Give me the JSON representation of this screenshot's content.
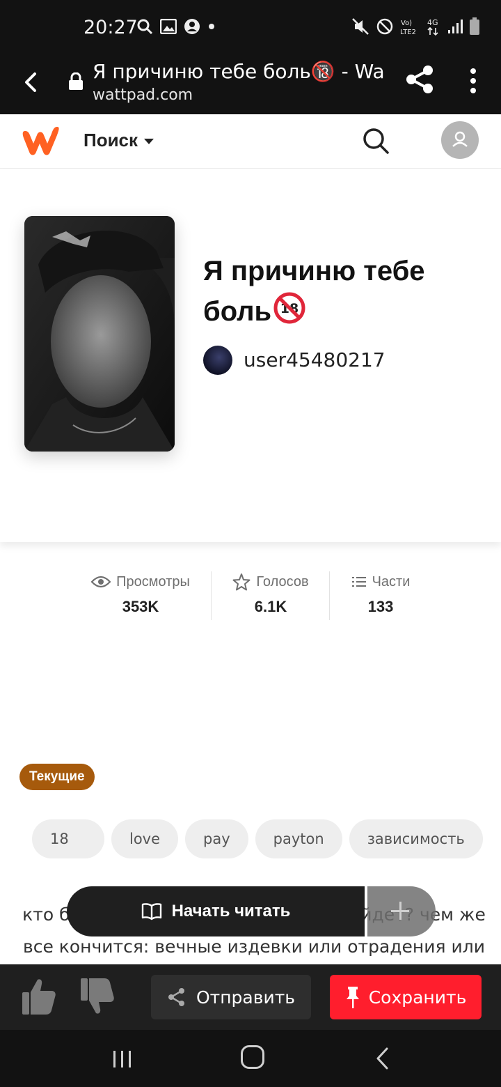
{
  "status_bar": {
    "time": "20:27"
  },
  "browser": {
    "page_title": "Я причиню тебе боль🔞 - Wattpad",
    "url": "wattpad.com"
  },
  "header": {
    "search_label": "Поиск"
  },
  "story": {
    "title": "Я причиню тебе боль",
    "author": "user45480217"
  },
  "stats": [
    {
      "label": "Просмотры",
      "value": "353K",
      "icon": "eye-icon"
    },
    {
      "label": "Голосов",
      "value": "6.1K",
      "icon": "star-icon"
    },
    {
      "label": "Части",
      "value": "133",
      "icon": "list-icon"
    }
  ],
  "status_badge": "Текущие",
  "tags": [
    "18",
    "love",
    "pay",
    "payton",
    "зависимость"
  ],
  "description": "кто бы мог подумать, что все так выйдет? чем же все кончится: вечные издевки или отрадения или все встанет на свои места?",
  "actions": {
    "read_label": "Начать читать",
    "send_label": "Отправить",
    "save_label": "Сохранить"
  },
  "colors": {
    "brand": "#ff6122",
    "ongoing": "#a65a0c",
    "save": "#ff1e2d"
  }
}
